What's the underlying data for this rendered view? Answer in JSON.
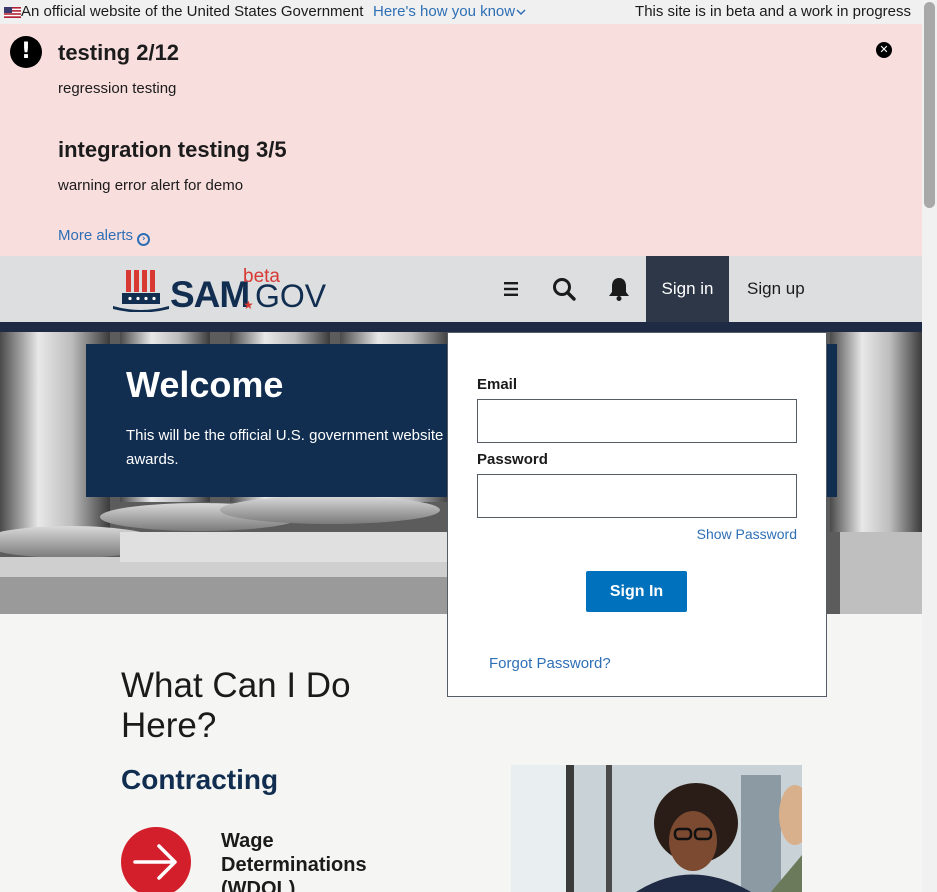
{
  "gov_banner": {
    "official_text": "An official website of the United States Government",
    "how_you_know": "Here's how you know",
    "beta_notice": "This site is in beta and a work in progress"
  },
  "alerts": {
    "items": [
      {
        "title": "testing 2/12",
        "body": "regression testing"
      },
      {
        "title": "integration testing 3/5",
        "body": "warning error alert for demo"
      }
    ],
    "more_alerts": "More alerts"
  },
  "header": {
    "logo_sam": "SAM",
    "logo_gov": "GOV",
    "logo_beta": "beta",
    "icons": [
      "menu-icon",
      "search-icon",
      "bell-icon"
    ],
    "sign_in": "Sign in",
    "sign_up": "Sign up"
  },
  "hero": {
    "title": "Welcome",
    "text": "This will be the official U.S. government website awards."
  },
  "signin_form": {
    "email_label": "Email",
    "email_value": "",
    "password_label": "Password",
    "password_value": "",
    "show_password": "Show Password",
    "submit": "Sign In",
    "forgot": "Forgot Password?"
  },
  "content": {
    "heading": "What Can I Do Here?",
    "section": "Contracting",
    "card_title": "Wage Determinations (WDOL)"
  },
  "colors": {
    "alert_bg": "#f9dede",
    "navy": "#112e51",
    "primary_button": "#0071bc",
    "link": "#2e6fb5",
    "red": "#d31f2b"
  }
}
